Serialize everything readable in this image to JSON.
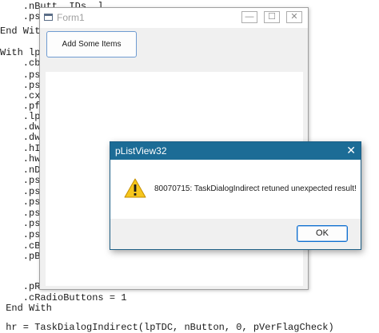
{
  "code_lines": [
    "    .nButt  IDs  l",
    "    .ps",
    "End With",
    "",
    "With lpT",
    "    .cb",
    "    .ps",
    "    .ps",
    "    .cx",
    "    .pf",
    "    .lp",
    "    .dw",
    "    .dw",
    "    .hI",
    "    .hw",
    "    .nD",
    "    .ps",
    "    .ps",
    "    .ps",
    "    .ps",
    "    .ps",
    "    .ps",
    "    .cB",
    "    .pB",
    "",
    "    .pR",
    "    .cRadioButtons = 1",
    " End With",
    "",
    " hr = TaskDialogIndirect(lpTDC, nButton, 0, pVerFlagCheck)"
  ],
  "form1": {
    "title": "Form1",
    "minimize_glyph": "—",
    "maximize_glyph": "☐",
    "close_glyph": "✕",
    "add_button_label": "Add Some Items"
  },
  "dialog": {
    "title": "pListView32",
    "close_glyph": "✕",
    "message": "80070715: TaskDialogIndirect retuned unexpected result!",
    "icon": "warning-icon",
    "ok_label": "OK"
  }
}
